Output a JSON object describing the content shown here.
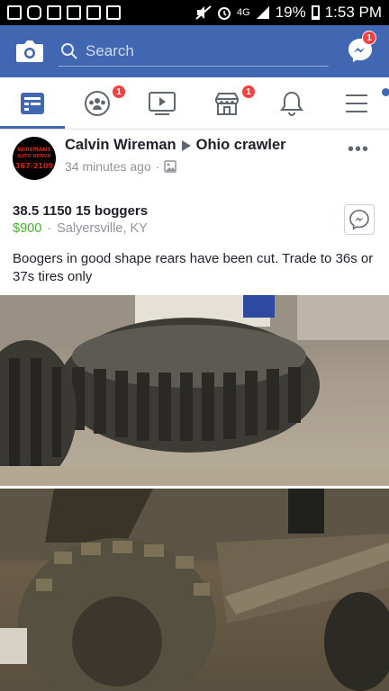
{
  "status_bar": {
    "battery": "19%",
    "time": "1:53 PM",
    "network": "4G"
  },
  "top_bar": {
    "search_placeholder": "Search",
    "messenger_badge": "1",
    "color": "#4267b2"
  },
  "nav": {
    "tabs": [
      {
        "name": "news-feed",
        "active": true,
        "badge": ""
      },
      {
        "name": "groups",
        "active": false,
        "badge": "1"
      },
      {
        "name": "watch",
        "active": false,
        "badge": ""
      },
      {
        "name": "marketplace",
        "active": false,
        "badge": "1"
      },
      {
        "name": "notifications",
        "active": false,
        "badge": ""
      },
      {
        "name": "menu",
        "active": false,
        "badge": ""
      }
    ]
  },
  "post": {
    "author": "Calvin Wireman",
    "group": "Ohio crawler",
    "time": "34 minutes ago",
    "avatar_text": {
      "line1": "WIREMANS",
      "line2": "AUTO REPAIR",
      "line3": "367-2109"
    },
    "listing_title": "38.5 1150 15 boggers",
    "price": "$900",
    "location": "Salyersville, KY",
    "description": "Boogers in good shape rears have been cut. Trade to 36s or 37s tires only",
    "price_color": "#42b72a"
  }
}
